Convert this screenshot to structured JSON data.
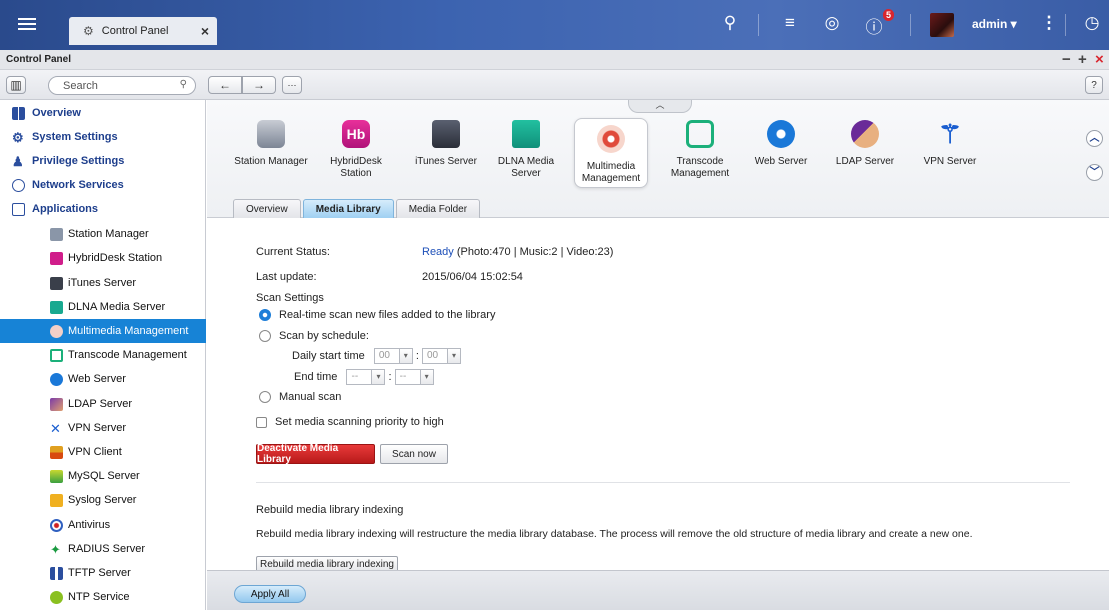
{
  "topbar": {
    "tab_label": "Control Panel",
    "notification_count": "5",
    "user": "admin ▾"
  },
  "window": {
    "title": "Control Panel"
  },
  "toolbar": {
    "search_placeholder": "Search",
    "help": "?"
  },
  "sidebar": {
    "top_items": [
      "Overview",
      "System Settings",
      "Privilege Settings",
      "Network Services",
      "Applications"
    ],
    "sub_items": [
      "Station Manager",
      "HybridDesk Station",
      "iTunes Server",
      "DLNA Media Server",
      "Multimedia Management",
      "Transcode Management",
      "Web Server",
      "LDAP Server",
      "VPN Server",
      "VPN Client",
      "MySQL Server",
      "Syslog Server",
      "Antivirus",
      "RADIUS Server",
      "TFTP Server",
      "NTP Service"
    ],
    "active": "Multimedia Management"
  },
  "apps": [
    {
      "l1": "Station Manager",
      "l2": ""
    },
    {
      "l1": "HybridDesk",
      "l2": "Station"
    },
    {
      "l1": "iTunes Server",
      "l2": ""
    },
    {
      "l1": "DLNA Media",
      "l2": "Server"
    },
    {
      "l1": "Multimedia",
      "l2": "Management"
    },
    {
      "l1": "Transcode",
      "l2": "Management"
    },
    {
      "l1": "Web Server",
      "l2": ""
    },
    {
      "l1": "LDAP Server",
      "l2": ""
    },
    {
      "l1": "VPN Server",
      "l2": ""
    }
  ],
  "tabs": [
    "Overview",
    "Media Library",
    "Media Folder"
  ],
  "form": {
    "status_label": "Current Status:",
    "status_value": "Ready",
    "status_detail": " (Photo:470  |  Music:2  |  Video:23)",
    "update_label": "Last update:",
    "update_value": "2015/06/04 15:02:54",
    "scan_settings": "Scan Settings",
    "opt_realtime": "Real-time scan new files added to the library",
    "opt_schedule": "Scan by schedule:",
    "daily_start": "Daily start time",
    "end_time": "End time",
    "start_hour": "00",
    "start_min": "00",
    "end_hour": "--",
    "end_min": "--",
    "opt_manual": "Manual scan",
    "priority": "Set media scanning priority to high",
    "btn_deactivate": "Deactivate Media Library",
    "btn_scan": "Scan now",
    "rebuild_title": "Rebuild media library indexing",
    "rebuild_desc": "Rebuild media library indexing will restructure the media library database. The process will remove the old structure of media library and create a new one.",
    "btn_rebuild": "Rebuild media library indexing"
  },
  "bottom": {
    "apply_all": "Apply All"
  },
  "colors": {
    "accent": "#1783d6",
    "danger": "#c8202a",
    "status_ready": "#1d4fb8"
  }
}
